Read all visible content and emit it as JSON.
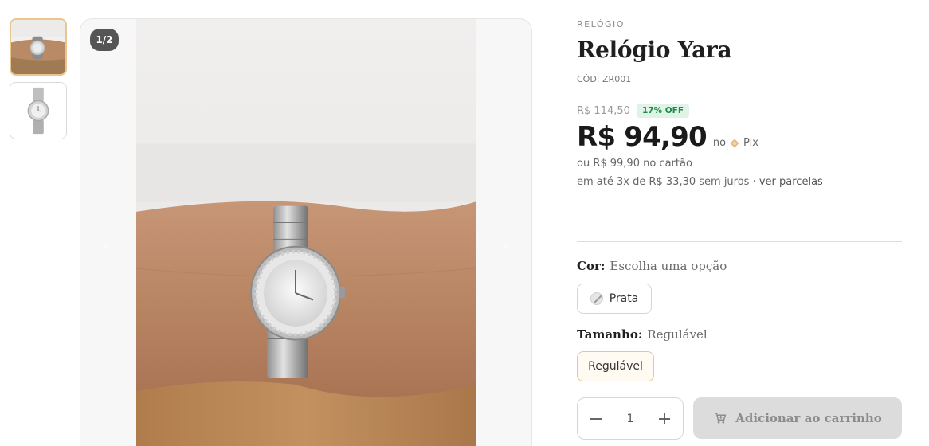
{
  "gallery": {
    "counter": "1/2",
    "thumbnails": [
      {
        "name": "wrist-photo",
        "active": true
      },
      {
        "name": "product-photo",
        "active": false
      }
    ]
  },
  "product": {
    "category": "RELÓGIO",
    "title": "Relógio Yara",
    "sku": "CÓD: ZR001",
    "old_price": "R$ 114,50",
    "discount_badge": "17% OFF",
    "price": "R$ 94,90",
    "pix_prefix": "no",
    "pix_label": "Pix",
    "card_price": "ou R$ 99,90 no cartão",
    "installments": "em até 3x de R$ 33,30 sem juros · ",
    "installments_link": "ver parcelas"
  },
  "options": {
    "color": {
      "label": "Cor:",
      "value": "Escolha uma opção",
      "choices": [
        "Prata"
      ]
    },
    "size": {
      "label": "Tamanho:",
      "value": "Regulável",
      "choices": [
        "Regulável"
      ]
    }
  },
  "cart": {
    "quantity": "1",
    "add_label": "Adicionar ao carrinho"
  },
  "colors": {
    "accent_border": "#e9c690",
    "badge_bg": "#dff3e6",
    "badge_text": "#1f8a4a",
    "button_disabled": "#dcdcdc"
  }
}
